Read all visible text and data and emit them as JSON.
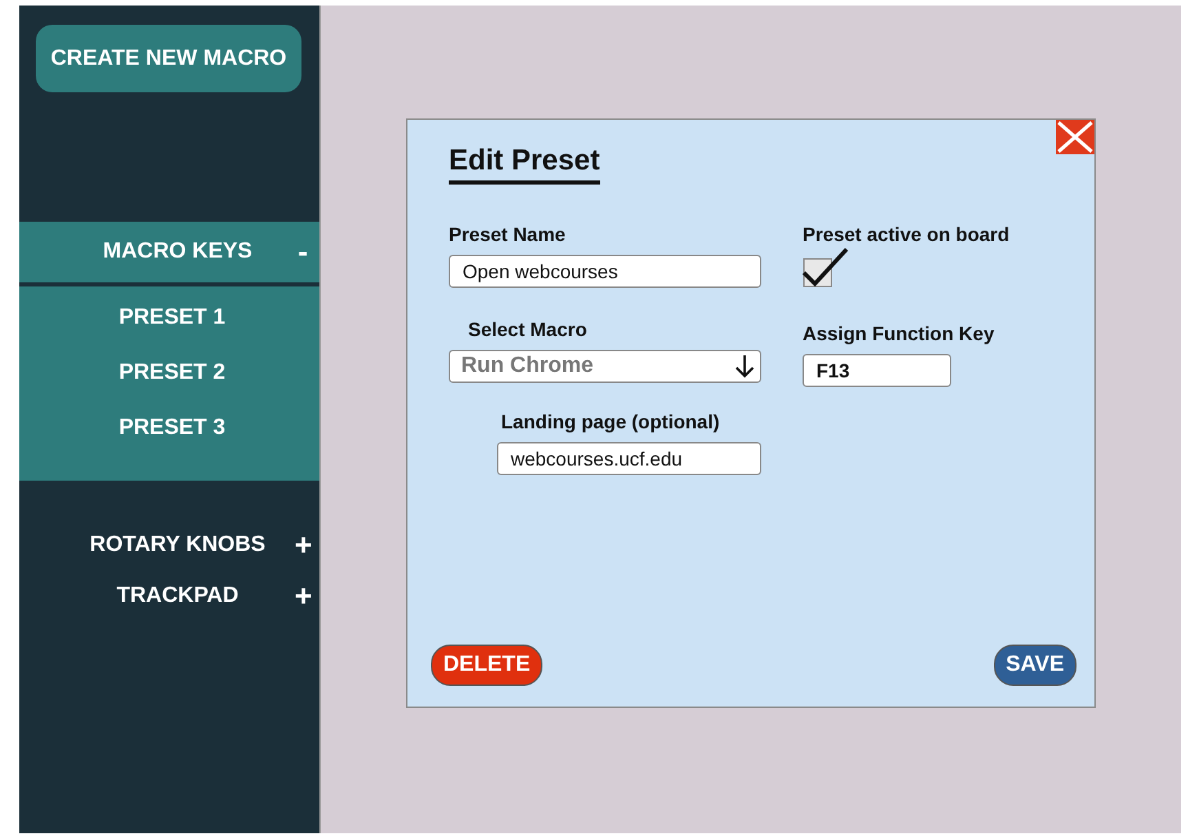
{
  "sidebar": {
    "create_button": "CREATE NEW MACRO",
    "sections": [
      {
        "label": "MACRO KEYS",
        "toggle": "-",
        "expanded": true,
        "items": [
          {
            "label": "PRESET 1"
          },
          {
            "label": "PRESET 2"
          },
          {
            "label": "PRESET 3"
          }
        ]
      },
      {
        "label": "ROTARY KNOBS",
        "toggle": "+",
        "expanded": false
      },
      {
        "label": "TRACKPAD",
        "toggle": "+",
        "expanded": false
      }
    ]
  },
  "dialog": {
    "title": "Edit Preset",
    "preset_name": {
      "label": "Preset Name",
      "value": "Open webcourses"
    },
    "select_macro": {
      "label": "Select Macro",
      "value": "Run Chrome"
    },
    "landing_page": {
      "label": "Landing page (optional)",
      "value": "webcourses.ucf.edu"
    },
    "preset_active": {
      "label": "Preset active on board",
      "checked": true
    },
    "function_key": {
      "label": "Assign Function Key",
      "value": "F13"
    },
    "delete_button": "DELETE",
    "save_button": "SAVE"
  }
}
